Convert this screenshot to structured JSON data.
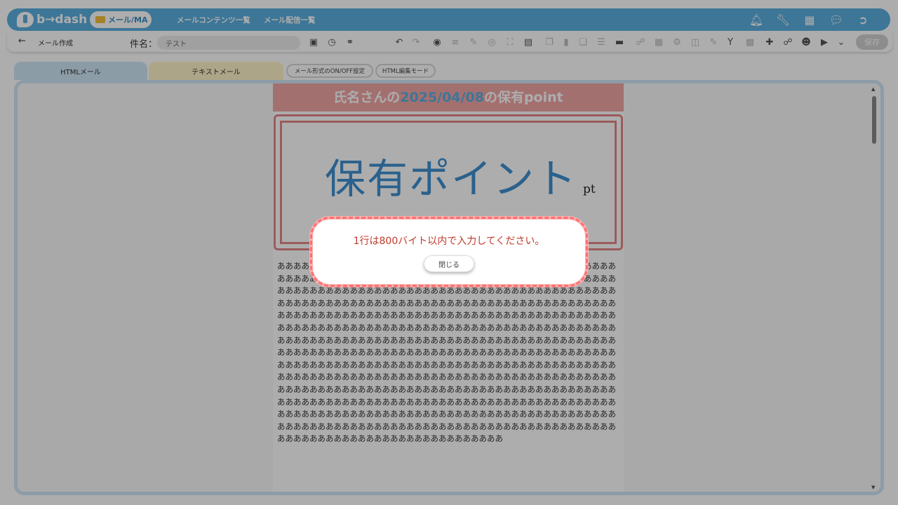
{
  "app": {
    "logo_text": "b→dash",
    "module_pill": "メール/MA"
  },
  "nav": {
    "link1": "メールコンテンツ一覧",
    "link2": "メール配信一覧"
  },
  "top_icons": [
    "bell-icon",
    "wrench-icon",
    "grid-icon",
    "chat-icon",
    "logout-icon"
  ],
  "subbar": {
    "back_glyph": "←",
    "page_title": "メール作成",
    "subject_label": "件名：",
    "subject_value": "テスト",
    "save_label": "保存"
  },
  "tabs": {
    "html_tab": "HTMLメール",
    "text_tab": "テキストメール",
    "chip_format": "メール形式のON/OFF設定",
    "chip_html_edit": "HTML編集モード"
  },
  "mail": {
    "header_name": "氏名",
    "header_san": "さんの",
    "header_date": "2025/04/08",
    "header_rest": "の保有point",
    "big_text": "保有ポイント",
    "unit": "pt",
    "body_text": "ああああああああああああああああああああああああああああああああああああああああああああああああああああああああああああああああああああああああああああああああああああああああああああああああああああああああああああああああああああああああああああああああああああああああああああああああああああああああああああああああああああああああああああああああああああああああああああああああああああああああああああああああああああああああああああああああああああああああああああああああああああああああああああああああああああああああああああああああああああああああああああああああああああああああああああああああああああああああああああああああああああああああああああああああああああああああああああああああああああああああああああああああああああああああああああああああああああああああああああああああああああああああああああああああああああああああああああああああああああああああああああああああああああああああああああああああああああああああああああああああああああああああああああああああああああああああああああああああああああああああああああああああああああああああああああああああああああああああああああああああああああああああああああああああああああああああああああああああああああああああああああああああああああああああ"
  },
  "modal": {
    "message": "1行は800バイト以内で入力してください。",
    "close_label": "閉じる"
  },
  "colors": {
    "brand_blue": "#5aaedf",
    "header_pink": "#f1a5a5",
    "error_red": "#c0392b"
  }
}
